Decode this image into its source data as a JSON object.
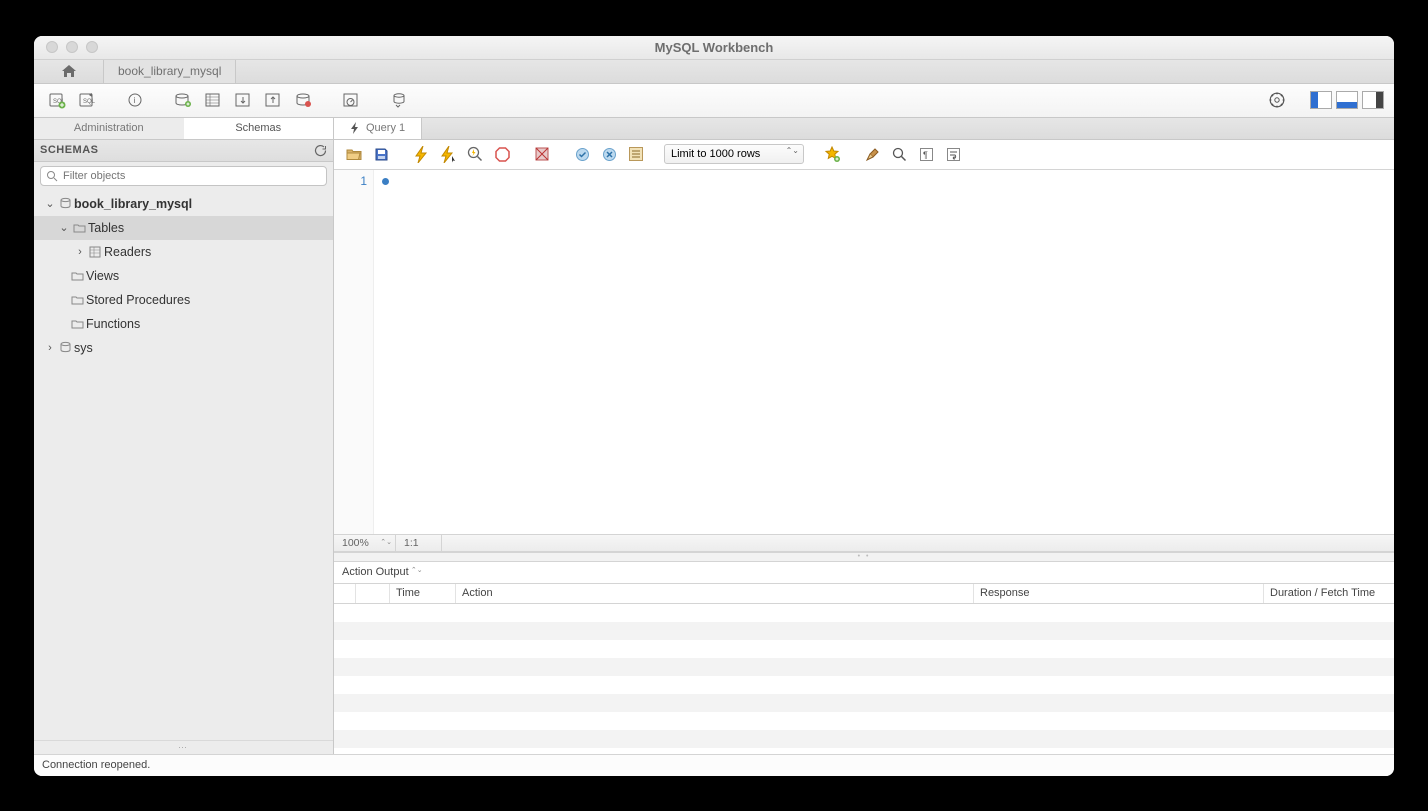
{
  "titlebar": {
    "title": "MySQL Workbench"
  },
  "connTab": {
    "label": "book_library_mysql"
  },
  "sidebar": {
    "tab_admin": "Administration",
    "tab_schemas": "Schemas",
    "header": "SCHEMAS",
    "filter_placeholder": "Filter objects",
    "schema1": "book_library_mysql",
    "tables": "Tables",
    "table1": "Readers",
    "views": "Views",
    "stored": "Stored Procedures",
    "functions": "Functions",
    "schema2": "sys"
  },
  "queryTab": {
    "label": "Query 1"
  },
  "editorToolbar": {
    "limit": "Limit to 1000 rows"
  },
  "editor": {
    "line1": "1"
  },
  "miniStatus": {
    "zoom": "100%",
    "ratio": "1:1"
  },
  "output": {
    "selector": "Action Output",
    "columns": {
      "time": "Time",
      "action": "Action",
      "response": "Response",
      "duration": "Duration / Fetch Time"
    }
  },
  "statusbar": {
    "message": "Connection reopened."
  }
}
